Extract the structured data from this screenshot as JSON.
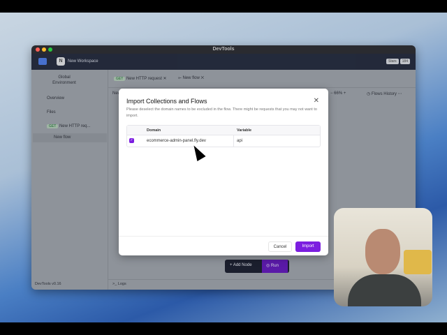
{
  "window": {
    "title": "DevTools"
  },
  "header": {
    "workspace_initial": "N",
    "workspace_name": "New Workspace",
    "stars_label": "Stars",
    "stars_count": "184"
  },
  "sidebar": {
    "environment": "Global Environment",
    "overview": "Overview",
    "files": "Files",
    "items": [
      {
        "method": "GET",
        "label": "New HTTP req..."
      },
      {
        "label": "New flow"
      }
    ],
    "version": "DevTools v0.16"
  },
  "tabs": [
    {
      "method": "GET",
      "label": "New HTTP request"
    },
    {
      "label": "New flow"
    }
  ],
  "toolbar": {
    "zoom": "66%",
    "flows_history": "Flows History",
    "breadcrumb": "New"
  },
  "modal": {
    "title": "Import Collections and Flows",
    "description": "Please deselect the domain names to be excluded in the flow. There might be requests that you may not want to import.",
    "columns": [
      "Domain",
      "Variable"
    ],
    "rows": [
      {
        "checked": true,
        "domain": "ecommerce-admin-panel.fly.dev",
        "variable": "api"
      }
    ],
    "cancel": "Cancel",
    "import": "Import"
  },
  "canvas_actions": {
    "add_node": "Add Node",
    "run": "Run"
  },
  "logs": "Logs",
  "colors": {
    "accent": "#7c1ee0",
    "header": "#11172a"
  }
}
